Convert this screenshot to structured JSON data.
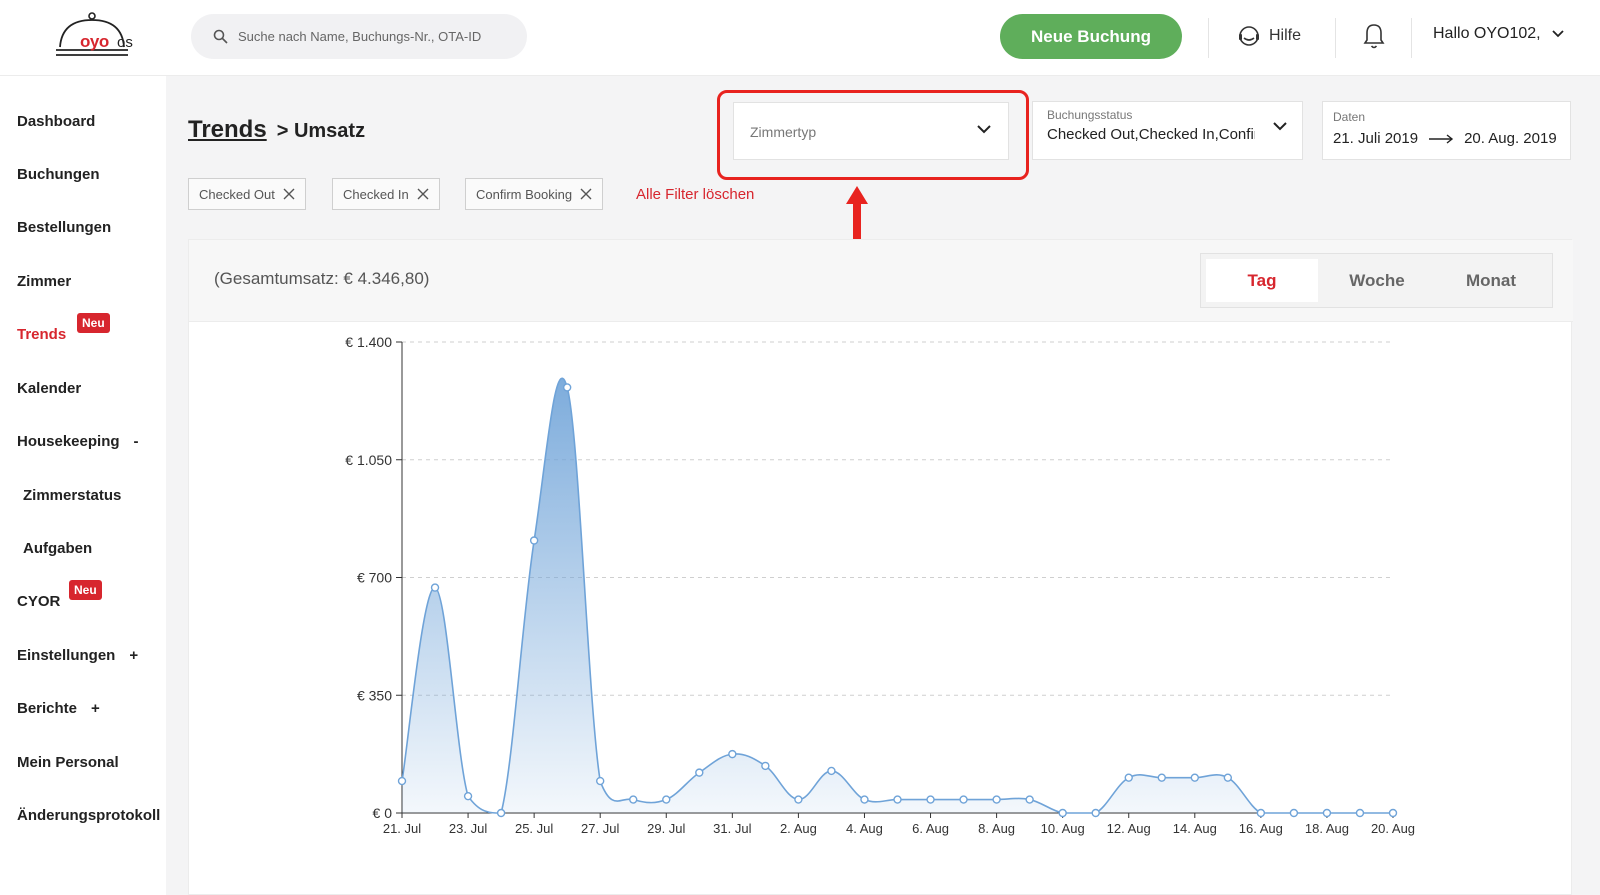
{
  "header": {
    "logo_text": "oyo",
    "logo_suffix": "os",
    "search_placeholder": "Suche nach Name, Buchungs-Nr., OTA-ID",
    "new_booking": "Neue Buchung",
    "help": "Hilfe",
    "user": "Hallo OYO102,"
  },
  "sidebar": {
    "items": [
      {
        "label": "Dashboard"
      },
      {
        "label": "Buchungen"
      },
      {
        "label": "Bestellungen"
      },
      {
        "label": "Zimmer"
      },
      {
        "label": "Trends",
        "badge": "Neu"
      },
      {
        "label": "Kalender"
      },
      {
        "label": "Housekeeping",
        "sign": "-"
      },
      {
        "label": "Zimmerstatus"
      },
      {
        "label": "Aufgaben"
      },
      {
        "label": "CYOR",
        "badge": "Neu"
      },
      {
        "label": "Einstellungen",
        "sign": "+"
      },
      {
        "label": "Berichte",
        "sign": "+"
      },
      {
        "label": "Mein Personal"
      },
      {
        "label": "Änderungsprotokoll"
      }
    ]
  },
  "breadcrumb": {
    "parent": "Trends",
    "current": "> Umsatz"
  },
  "filters": {
    "room_type_placeholder": "Zimmertyp",
    "status_label": "Buchungsstatus",
    "status_value": "Checked Out,Checked In,Confirm Booking",
    "date_label": "Daten",
    "date_from": "21. Juli 2019",
    "date_to": "20. Aug. 2019",
    "chips": [
      "Checked Out",
      "Checked In",
      "Confirm Booking"
    ],
    "clear_all": "Alle Filter löschen"
  },
  "summary": {
    "total": "(Gesamtumsatz: € 4.346,80)"
  },
  "period_toggle": {
    "day": "Tag",
    "week": "Woche",
    "month": "Monat",
    "active": "day"
  },
  "colors": {
    "accent": "#d7262e",
    "primary_button": "#5fae5b",
    "series": "#6fa3d8",
    "highlight": "#e8231f"
  },
  "chart_data": {
    "type": "area",
    "ylim": [
      0,
      1400
    ],
    "y_ticks": [
      "€ 0",
      "€ 350",
      "€ 700",
      "€ 1.050",
      "€ 1.400"
    ],
    "y_tick_values": [
      0,
      350,
      700,
      1050,
      1400
    ],
    "x_tick_labels": [
      "21. Jul",
      "23. Jul",
      "25. Jul",
      "27. Jul",
      "29. Jul",
      "31. Jul",
      "2. Aug",
      "4. Aug",
      "6. Aug",
      "8. Aug",
      "10. Aug",
      "12. Aug",
      "14. Aug",
      "16. Aug",
      "18. Aug",
      "20. Aug"
    ],
    "grid": true,
    "series": [
      {
        "values": [
          95,
          670,
          50,
          0,
          810,
          1265,
          95,
          40,
          40,
          120,
          175,
          140,
          40,
          125,
          40,
          40,
          40,
          40,
          40,
          40,
          0,
          0,
          105,
          105,
          105,
          105,
          0,
          0,
          0,
          0,
          0
        ]
      }
    ]
  }
}
